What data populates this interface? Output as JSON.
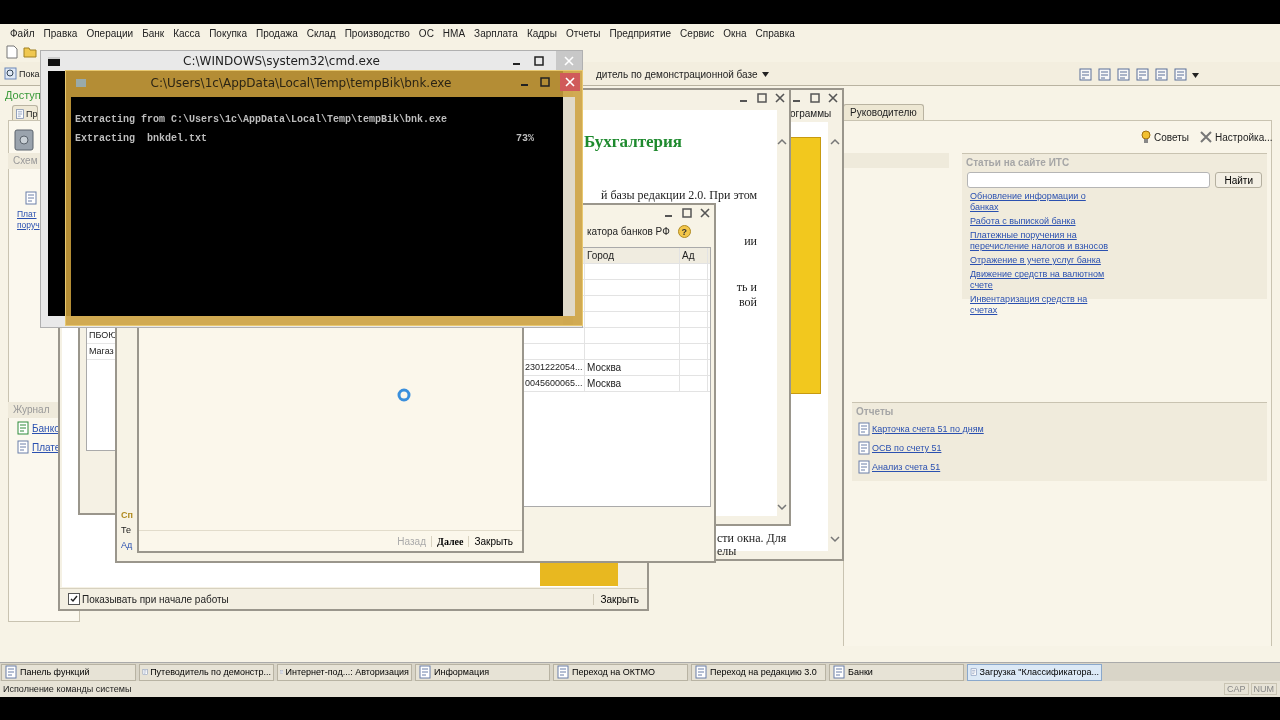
{
  "menu_bar": {
    "items": [
      "Файл",
      "Правка",
      "Операции",
      "Банк",
      "Касса",
      "Покупка",
      "Продажа",
      "Склад",
      "Производство",
      "ОС",
      "НМА",
      "Зарплата",
      "Кадры",
      "Отчеты",
      "Предприятие",
      "Сервис",
      "Окна",
      "Справка"
    ]
  },
  "toolbar": {
    "left_label": "Пока",
    "section_title": "дитель по демонстрационной базе"
  },
  "left_panel": {
    "title": "Доступ",
    "tab": "Пр",
    "group_title": "Схем",
    "link_lines": [
      "Плат",
      "поруч"
    ],
    "journals_title": "Журнал",
    "journal_links": [
      "Банко",
      "Плате"
    ]
  },
  "right_panel": {
    "tab": "Руководителю",
    "actions": [
      "Советы",
      "Настройка..."
    ],
    "its_articles": {
      "title": "Статьи на сайте ИТС",
      "search_button": "Найти",
      "links": [
        "Обновление информации о банках",
        "Работа с выпиской банка",
        "Платежные поручения на перечисление налогов и взносов",
        "Отражение в учете услуг банка",
        "Движение средств на валютном счете",
        "Инвентаризация средств на счетах"
      ]
    },
    "reports": {
      "title": "Отчеты",
      "links": [
        "Карточка счета 51 по дням",
        "ОСВ по счету 51",
        "Анализ счета 51"
      ]
    }
  },
  "guide_window": {
    "show_on_start": {
      "label": "Показывать при начале работы",
      "checked": true
    },
    "close_button": "Закрыть"
  },
  "journal_window": {
    "cells": [
      "ПБОЮ",
      "Магаз"
    ]
  },
  "info_window": {
    "heading": "Бухгалтерия",
    "text_lines": [
      "й базы редакции 2.0. При этом",
      "ии",
      "ть и",
      "вой"
    ]
  },
  "programs_window": {
    "tab": "ограммы",
    "text_lines": [
      "сти окна. Для",
      "елы"
    ]
  },
  "banks_window": {
    "toolbar_text": "катора банков РФ",
    "help_button": "?",
    "columns": [
      "Город",
      "Ад"
    ],
    "rows": [
      {
        "code": "2301222054...",
        "city": "Москва"
      },
      {
        "code": "0045600065...",
        "city": "Москва"
      }
    ],
    "footer_title": "Сп",
    "footer_text": "Те",
    "footer_link": "Ад"
  },
  "loading_wizard": {
    "buttons": [
      {
        "label": "Назад",
        "disabled": true,
        "default": false
      },
      {
        "label": "Далее",
        "disabled": false,
        "default": true
      },
      {
        "label": "Закрыть",
        "disabled": false,
        "default": false
      }
    ]
  },
  "cmd_window": {
    "title": "C:\\WINDOWS\\system32\\cmd.exe"
  },
  "extract_window": {
    "title": "C:\\Users\\1c\\AppData\\Local\\Temp\\tempBik\\bnk.exe",
    "lines": [
      "Extracting from C:\\Users\\1c\\AppData\\Local\\Temp\\tempBik\\bnk.exe"
    ],
    "current_file": "Extracting  bnkdel.txt",
    "percent": "73%"
  },
  "taskbar": [
    {
      "label": "Панель функций",
      "selected": false
    },
    {
      "label": "Путеводитель по демонстр...",
      "selected": false
    },
    {
      "label": "Интернет-под...: Авторизация",
      "selected": false
    },
    {
      "label": "Информация",
      "selected": false
    },
    {
      "label": "Переход на ОКТМО",
      "selected": false
    },
    {
      "label": "Переход на редакцию 3.0",
      "selected": false
    },
    {
      "label": "Банки",
      "selected": false
    },
    {
      "label": "Загрузка \"Классификатора...",
      "selected": true
    }
  ],
  "status_bar": {
    "text": "Исполнение команды системы",
    "indicators": [
      "CAP",
      "NUM"
    ]
  }
}
